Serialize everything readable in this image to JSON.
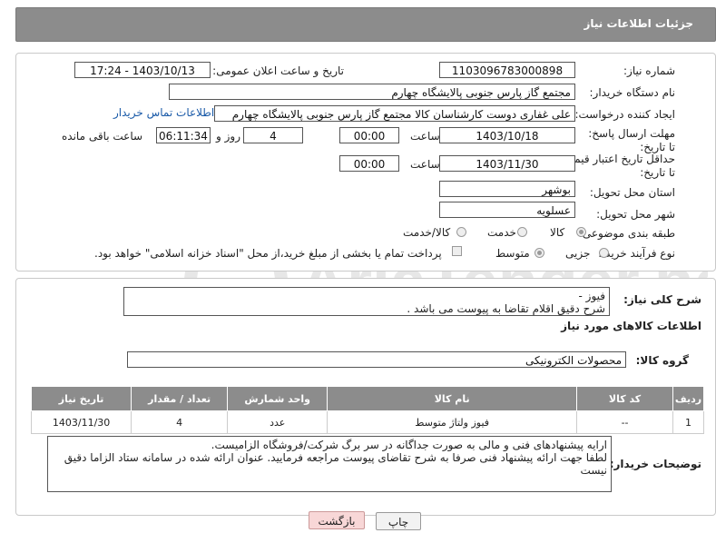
{
  "header": {
    "title": "جزئیات اطلاعات نیاز"
  },
  "form": {
    "need_number_label": "شماره نیاز:",
    "need_number": "1103096783000898",
    "announce_label": "تاریخ و ساعت اعلان عمومی:",
    "announce_value": "1403/10/13 - 17:24",
    "buyer_org_label": "نام دستگاه خریدار:",
    "buyer_org": "مجتمع گاز پارس جنوبی  پالایشگاه چهارم",
    "creator_label": "ایجاد کننده درخواست:",
    "creator": "علی غفاری دوست کارشناسان کالا مجتمع گاز پارس جنوبی  پالایشگاه چهارم",
    "contact_link": "اطلاعات تماس خریدار",
    "deadline_label": "مهلت ارسال پاسخ: تا تاریخ:",
    "deadline_date": "1403/10/18",
    "time_label": "ساعت",
    "deadline_time": "00:00",
    "days_value": "4",
    "days_label": "روز و",
    "remaining_time": "06:11:34",
    "remaining_label": "ساعت باقی مانده",
    "price_valid_label": "حداقل تاریخ اعتبار قیمت: تا تاریخ:",
    "price_valid_date": "1403/11/30",
    "price_valid_time": "00:00",
    "province_label": "استان محل تحویل:",
    "province": "بوشهر",
    "city_label": "شهر محل تحویل:",
    "city": "عسلویه",
    "category_label": "طبقه بندی موضوعی:",
    "category_options": [
      "کالا",
      "خدمت",
      "کالا/خدمت"
    ],
    "process_label": "نوع فرآیند خرید :",
    "process_options": [
      "جزیی",
      "متوسط"
    ],
    "payment_text": "پرداخت تمام یا بخشی از مبلغ خرید،از محل \"اسناد خزانه اسلامی\" خواهد بود."
  },
  "description": {
    "label": "شرح کلی نیاز:",
    "line1": "فیوز -",
    "line2": "شرح دقیق اقلام تقاضا به پیوست می باشد ."
  },
  "goods": {
    "section_title": "اطلاعات کالاهای مورد نیاز",
    "group_label": "گروه کالا:",
    "group_value": "محصولات الکترونیکی",
    "columns": [
      "ردیف",
      "کد کالا",
      "نام کالا",
      "واحد شمارش",
      "تعداد / مقدار",
      "تاریخ نیاز"
    ],
    "rows": [
      [
        "1",
        "--",
        "فیوز ولتاژ متوسط",
        "عدد",
        "4",
        "1403/11/30"
      ]
    ]
  },
  "buyer_notes": {
    "label": "توضیحات خریدار:",
    "line1": "ارایه پیشنهادهای فنی و مالی به صورت جداگانه در سر برگ شرکت/فروشگاه الزامیست.",
    "line2": "لطفا جهت ارائه پیشنهاد فنی صرفا به شرح تقاضای پیوست مراجعه فرمایید. عنوان ارائه شده در سامانه ستاد الزاما دقیق نیست"
  },
  "buttons": {
    "print": "چاپ",
    "back": "بازگشت"
  },
  "watermark": {
    "text": "AriaTender.neT"
  },
  "colors": {
    "header_bg": "#8c8c8c",
    "link": "#1a5aa8",
    "back_bg": "#f8d7d7"
  }
}
